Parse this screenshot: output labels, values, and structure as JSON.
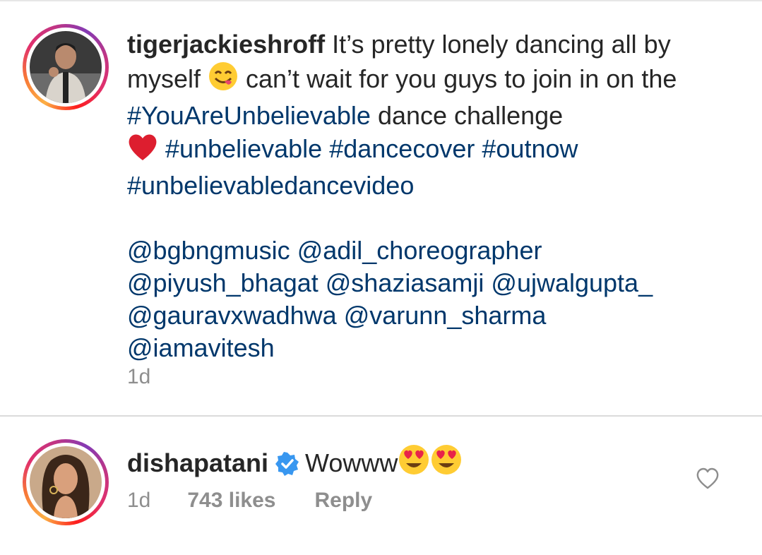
{
  "post": {
    "username": "tigerjackieshroff",
    "text_1": " It’s pretty lonely dancing all by myself ",
    "emoji_1_icon": "yum-face-emoji-icon",
    "text_2": " can’t wait for you guys to join in on the ",
    "hashtag_1": "#YouAreUnbelievable",
    "text_3": " dance challenge ",
    "heart_icon": "red-heart-emoji-icon",
    "hashtags": [
      "#unbelievable",
      "#dancecover",
      "#outnow",
      "#unbelievabledancevideo"
    ],
    "mentions": [
      "@bgbngmusic",
      "@adil_choreographer",
      "@piyush_bhagat",
      "@shaziasamji",
      "@ujwalgupta_",
      "@gauravxwadhwa",
      "@varunn_sharma",
      "@iamavitesh"
    ],
    "time": "1d"
  },
  "comment": {
    "username": "dishapatani",
    "verified_icon": "verified-badge-icon",
    "text": "Wowww",
    "emojis": [
      "heart-eyes-emoji-icon",
      "heart-eyes-emoji-icon"
    ],
    "time": "1d",
    "likes": "743 likes",
    "reply_label": "Reply",
    "like_icon": "heart-outline-icon"
  },
  "colors": {
    "link": "#00376b",
    "text": "#262626",
    "muted": "#8e8e8e",
    "verified": "#3897f0",
    "heart": "#ed4956"
  }
}
